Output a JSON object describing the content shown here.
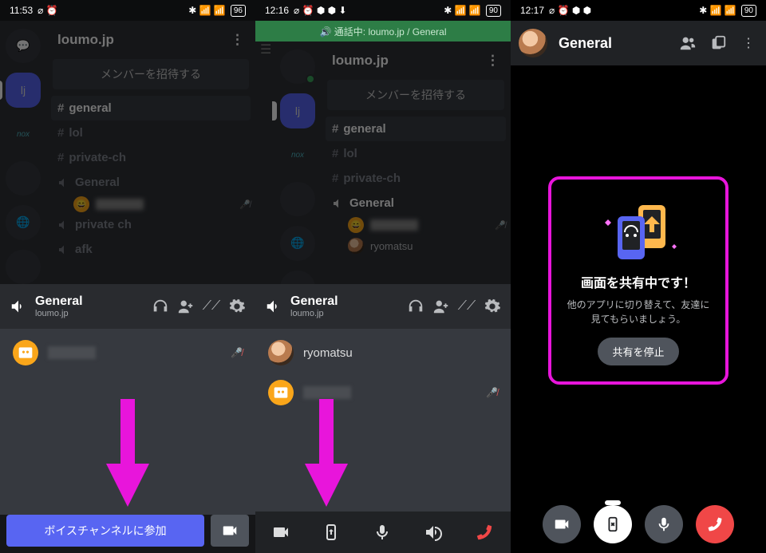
{
  "screens": [
    {
      "status": {
        "time": "11:53",
        "icons": "⌀ ⏰",
        "right": "✱ 📶 📶",
        "battery": "96"
      },
      "server": "loumo.jp",
      "invite": "メンバーを招待する",
      "channels": [
        "general",
        "lol",
        "private-ch"
      ],
      "voice_channels": [
        "General",
        "private ch",
        "afk"
      ],
      "voice_bar": {
        "name": "General",
        "sub": "loumo.jp"
      },
      "join_label": "ボイスチャンネルに参加"
    },
    {
      "status": {
        "time": "12:16",
        "icons": "⌀ ⏰ ⬢ ⬢ ⬇",
        "right": "✱ 📶 📶",
        "battery": "90"
      },
      "call_banner": "🔊 通話中: loumo.jp / General",
      "server": "loumo.jp",
      "invite": "メンバーを招待する",
      "channels": [
        "general",
        "lol",
        "private-ch"
      ],
      "voice_channels": [
        "General"
      ],
      "voice_member": "ryomatsu",
      "voice_bar": {
        "name": "General",
        "sub": "loumo.jp"
      },
      "member_name": "ryomatsu"
    },
    {
      "status": {
        "time": "12:17",
        "icons": "⌀ ⏰ ⬢ ⬢",
        "right": "✱ 📶 📶",
        "battery": "90"
      },
      "title": "General",
      "share": {
        "heading": "画面を共有中です！",
        "body": "他のアプリに切り替えて、友達に見てもらいましょう。",
        "stop": "共有を停止"
      }
    }
  ]
}
